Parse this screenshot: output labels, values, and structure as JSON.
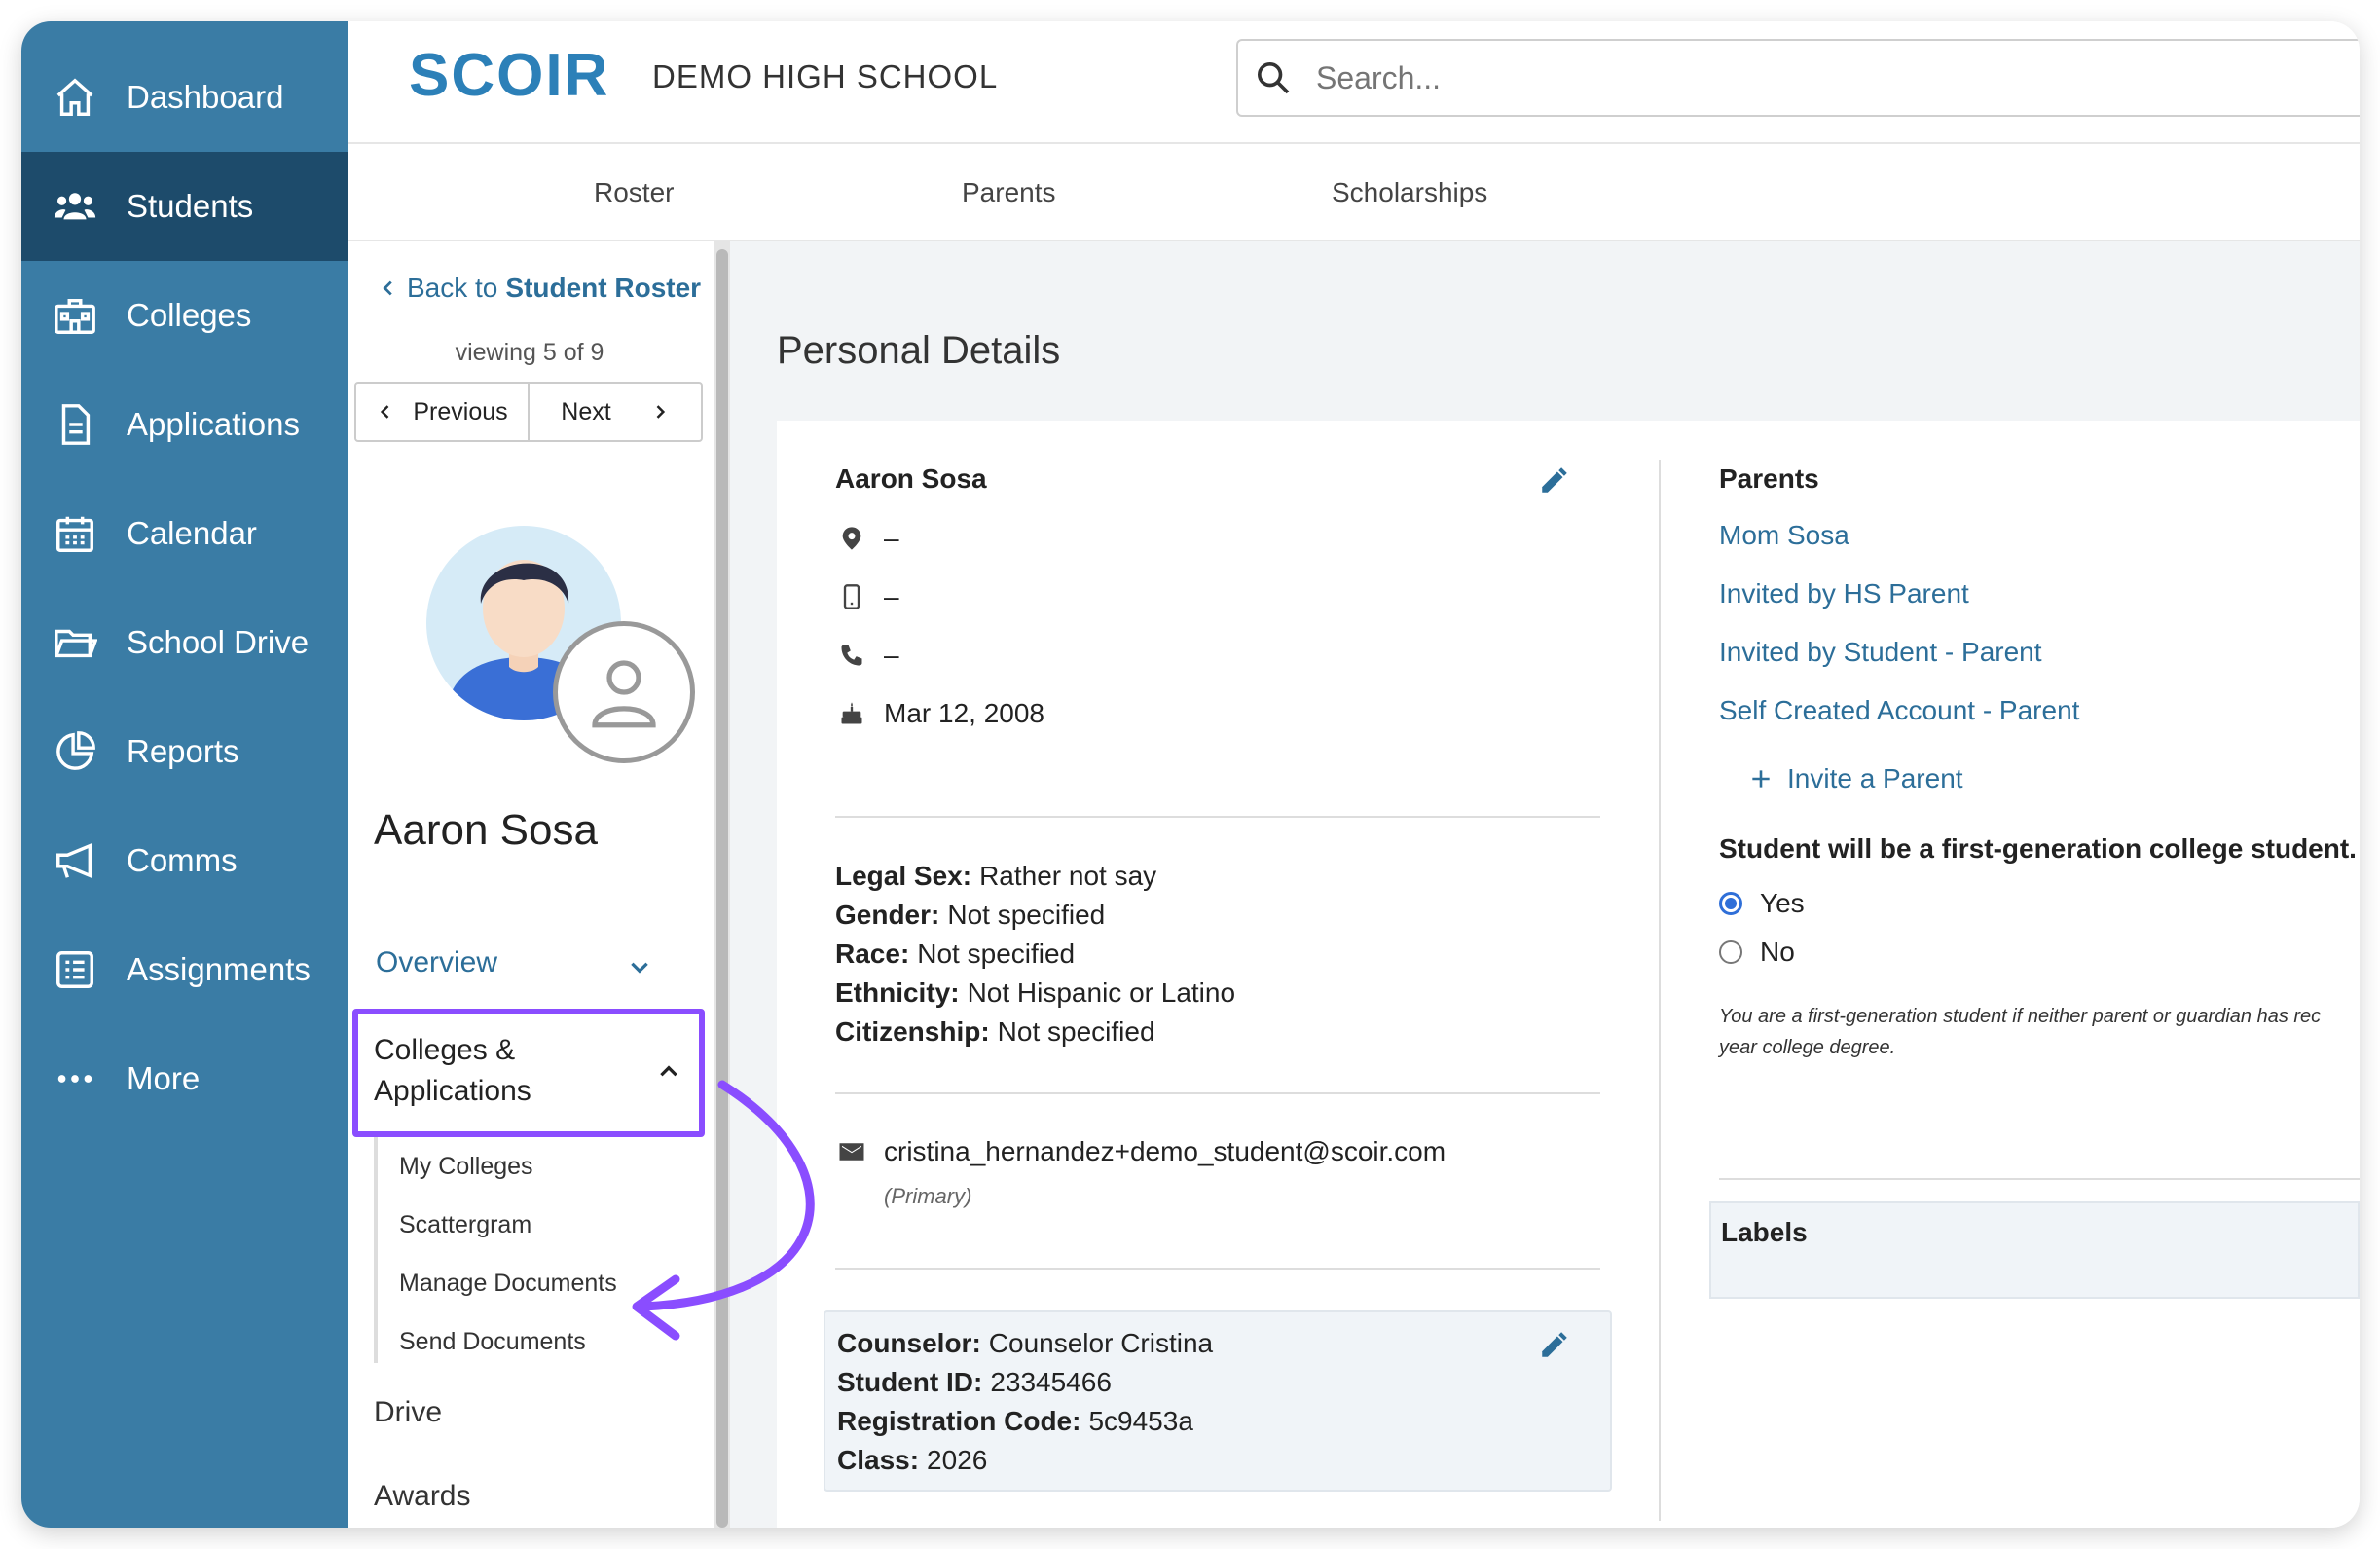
{
  "nav": {
    "items": [
      {
        "label": "Dashboard",
        "icon": "home-icon"
      },
      {
        "label": "Students",
        "icon": "users-icon",
        "active": true
      },
      {
        "label": "Colleges",
        "icon": "college-icon"
      },
      {
        "label": "Applications",
        "icon": "document-icon"
      },
      {
        "label": "Calendar",
        "icon": "calendar-icon"
      },
      {
        "label": "School Drive",
        "icon": "folder-icon"
      },
      {
        "label": "Reports",
        "icon": "pie-chart-icon"
      },
      {
        "label": "Comms",
        "icon": "megaphone-icon"
      },
      {
        "label": "Assignments",
        "icon": "checklist-icon"
      },
      {
        "label": "More",
        "icon": "ellipsis-icon"
      }
    ]
  },
  "header": {
    "logo": "SCOIR",
    "school": "DEMO HIGH SCHOOL",
    "search_placeholder": "Search..."
  },
  "subnav": {
    "tabs": [
      "Roster",
      "Parents",
      "Scholarships"
    ]
  },
  "student_sidebar": {
    "back_prefix": "Back to",
    "back_link": "Student Roster",
    "viewing": "viewing 5 of 9",
    "previous": "Previous",
    "next": "Next",
    "name": "Aaron Sosa",
    "overview": "Overview",
    "colleges_line1": "Colleges &",
    "colleges_line2": "Applications",
    "sub_items": [
      "My Colleges",
      "Scattergram",
      "Manage Documents",
      "Send Documents"
    ],
    "drive": "Drive",
    "awards": "Awards"
  },
  "main": {
    "title": "Personal Details",
    "name": "Aaron Sosa",
    "location": "–",
    "mobile": "–",
    "phone": "–",
    "birthday": "Mar 12, 2008",
    "demographics": [
      {
        "key": "Legal Sex:",
        "value": "Rather not say"
      },
      {
        "key": "Gender:",
        "value": "Not specified"
      },
      {
        "key": "Race:",
        "value": "Not specified"
      },
      {
        "key": "Ethnicity:",
        "value": "Not Hispanic or Latino"
      },
      {
        "key": "Citizenship:",
        "value": "Not specified"
      }
    ],
    "email": "cristina_hernandez+demo_student@scoir.com",
    "email_note": "(Primary)",
    "school_info": [
      {
        "key": "Counselor:",
        "value": "Counselor Cristina"
      },
      {
        "key": "Student ID:",
        "value": "23345466"
      },
      {
        "key": "Registration Code:",
        "value": "5c9453a"
      },
      {
        "key": "Class:",
        "value": "2026"
      }
    ],
    "parents_title": "Parents",
    "parents": [
      "Mom Sosa",
      "Invited by HS Parent",
      "Invited by Student - Parent",
      "Self Created Account - Parent"
    ],
    "invite": "Invite a Parent",
    "first_gen_question": "Student will be a first-generation college student.",
    "first_gen_yes": "Yes",
    "first_gen_no": "No",
    "first_gen_selected": "Yes",
    "first_gen_note_1": "You are a first-generation student if neither parent or guardian has rec",
    "first_gen_note_2": "year college degree.",
    "labels_title": "Labels"
  },
  "colors": {
    "nav_bg": "#3a7ca5",
    "nav_active": "#1d4b6b",
    "link": "#2c6e99",
    "highlight": "#8a4dff"
  }
}
